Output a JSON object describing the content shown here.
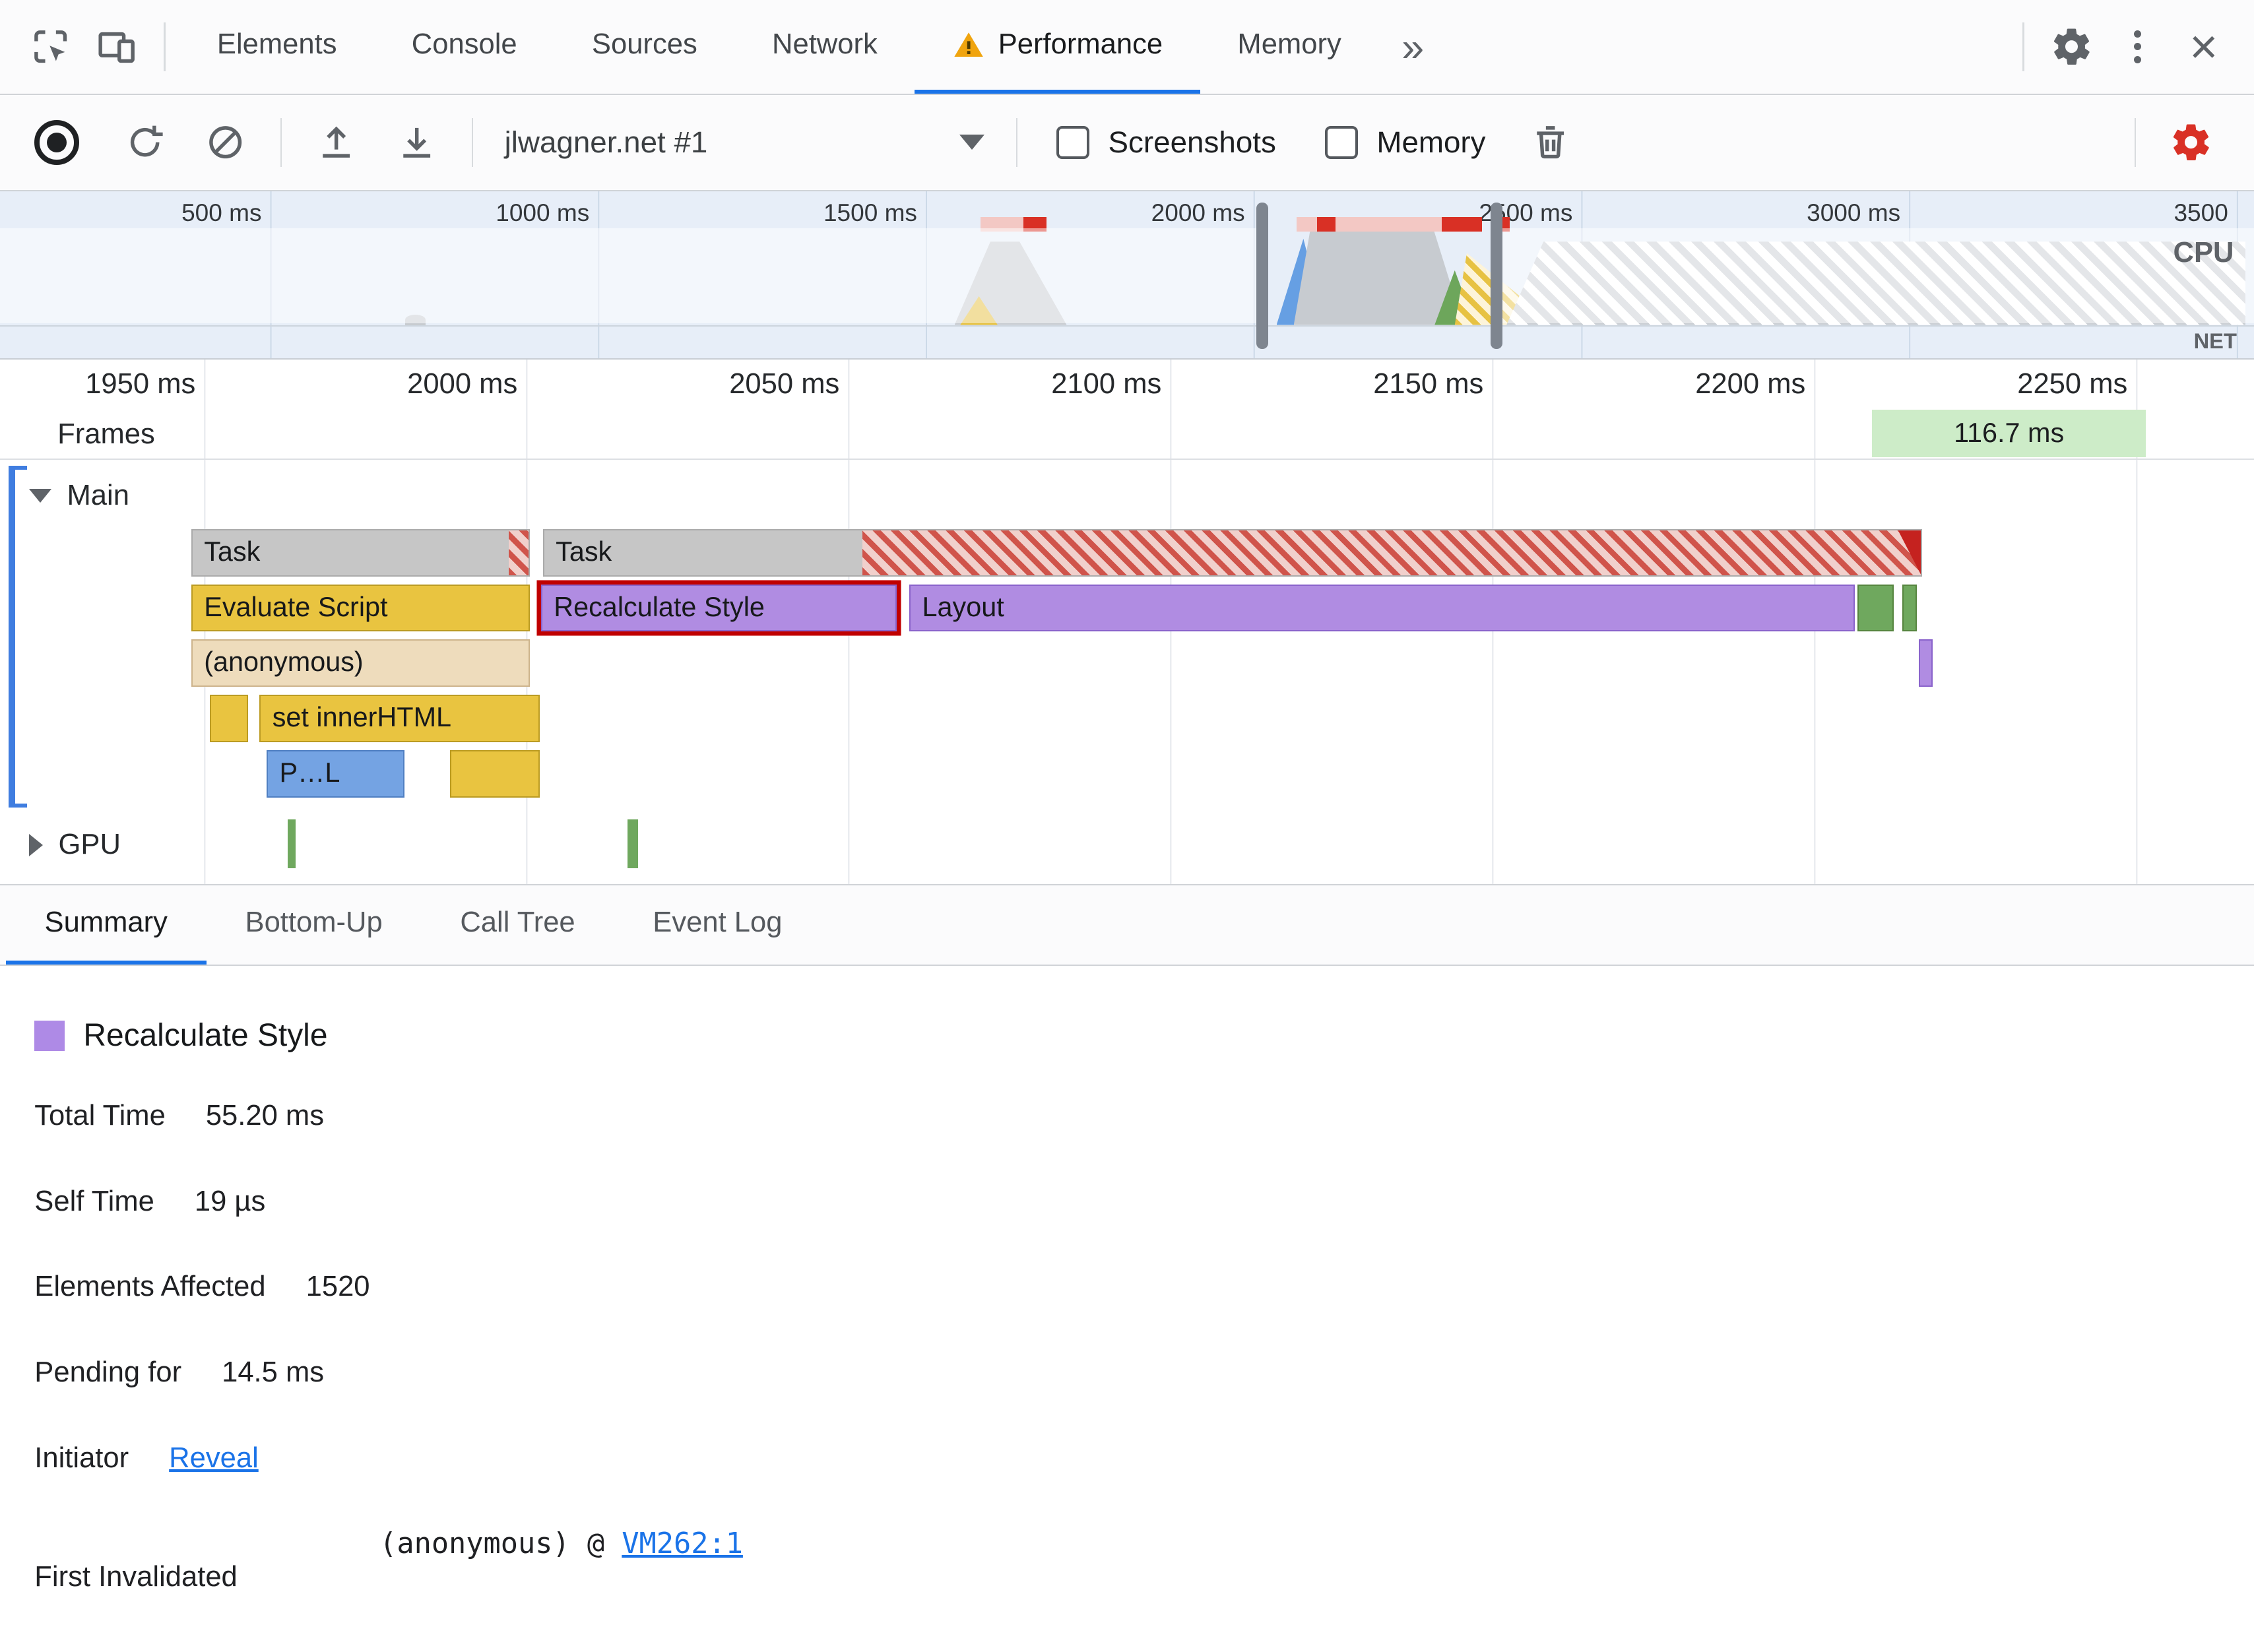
{
  "window": {
    "tabs": [
      {
        "label": "Elements"
      },
      {
        "label": "Console"
      },
      {
        "label": "Sources"
      },
      {
        "label": "Network"
      },
      {
        "label": "Performance",
        "active": true,
        "warning": true
      },
      {
        "label": "Memory"
      }
    ],
    "more_tabs_glyph": "»",
    "close_glyph": "×"
  },
  "toolbar": {
    "profile_name": "jlwagner.net #1",
    "screenshots_label": "Screenshots",
    "memory_label": "Memory"
  },
  "overview": {
    "time_labels": [
      "500 ms",
      "1000 ms",
      "1500 ms",
      "2000 ms",
      "2500 ms",
      "3000 ms",
      "3500"
    ],
    "cpu_label": "CPU",
    "net_label": "NET"
  },
  "timeline": {
    "ruler_labels": [
      "1950 ms",
      "2000 ms",
      "2050 ms",
      "2100 ms",
      "2150 ms",
      "2200 ms",
      "2250 ms"
    ],
    "frames_label": "Frames",
    "frame_block": {
      "start": 2209,
      "end": 2251.5,
      "label": "116.7 ms"
    },
    "main_label": "Main",
    "gpu_label": "GPU",
    "bars": [
      {
        "row": 0,
        "kind": "task",
        "label": "Task",
        "start": 1948,
        "end": 2000.6,
        "tip": true
      },
      {
        "row": 0,
        "kind": "task",
        "label": "Task",
        "start": 2002.6,
        "end": 2216.8,
        "hatch_from": 2052,
        "corner": true
      },
      {
        "row": 1,
        "kind": "script",
        "label": "Evaluate Script",
        "start": 1948,
        "end": 2000.6
      },
      {
        "row": 1,
        "kind": "style",
        "label": "Recalculate Style",
        "start": 2002.3,
        "end": 2057.5,
        "selected": true
      },
      {
        "row": 1,
        "kind": "style",
        "label": "Layout",
        "start": 2059.5,
        "end": 2206.3
      },
      {
        "row": 1,
        "kind": "paint",
        "start": 2206.7,
        "end": 2212.4
      },
      {
        "row": 1,
        "kind": "paint",
        "start": 2213.7,
        "end": 2215.6
      },
      {
        "row": 2,
        "kind": "anon",
        "label": "(anonymous)",
        "start": 1948,
        "end": 2000.6
      },
      {
        "row": 2,
        "kind": "style",
        "start": 2216.2,
        "end": 2217.2
      },
      {
        "row": 3,
        "kind": "script",
        "start": 1950.9,
        "end": 1956.8
      },
      {
        "row": 3,
        "kind": "script",
        "label": "set innerHTML",
        "start": 1958.6,
        "end": 2002.1
      },
      {
        "row": 4,
        "kind": "parse",
        "label": "P…L",
        "start": 1959.7,
        "end": 1981.1
      },
      {
        "row": 4,
        "kind": "script",
        "start": 1988.2,
        "end": 2002.1
      }
    ],
    "gpu_bars": [
      {
        "start": 1963,
        "end": 1964.2
      },
      {
        "start": 2015.7,
        "end": 2017.4
      }
    ]
  },
  "bottom_tabs": [
    {
      "label": "Summary",
      "active": true
    },
    {
      "label": "Bottom-Up"
    },
    {
      "label": "Call Tree"
    },
    {
      "label": "Event Log"
    }
  ],
  "summary": {
    "title": "Recalculate Style",
    "swatch_color": "#ae8ae6",
    "rows": [
      {
        "label": "Total Time",
        "value": "55.20 ms"
      },
      {
        "label": "Self Time",
        "value": "19 µs"
      },
      {
        "label": "Elements Affected",
        "value": "1520"
      },
      {
        "label": "Pending for",
        "value": "14.5 ms"
      },
      {
        "label": "Initiator",
        "link": "Reveal"
      },
      {
        "label": "First Invalidated",
        "mono_prefix": "(anonymous) @ ",
        "mono_link": "VM262:1"
      }
    ]
  },
  "colors": {
    "accent": "#1a73e8",
    "alert": "#d93025"
  }
}
